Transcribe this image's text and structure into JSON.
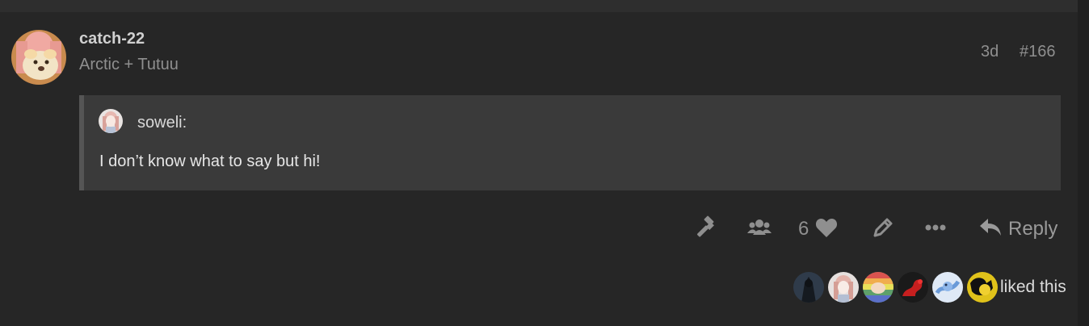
{
  "post": {
    "username": "catch-22",
    "user_title": "Arctic + Tutuu",
    "date": "3d",
    "post_number": "#166",
    "quote": {
      "author": "soweli:",
      "text": "I don’t know what to say but hi!"
    },
    "actions": {
      "like_count": "6",
      "reply_label": "Reply"
    },
    "likes": {
      "suffix": "liked this",
      "avatars": [
        "liker-1",
        "liker-2",
        "liker-3",
        "liker-4",
        "liker-5",
        "liker-6"
      ]
    }
  },
  "icons": [
    "gavel-icon",
    "group-icon",
    "heart-icon",
    "pencil-icon",
    "ellipsis-icon",
    "reply-arrow-icon"
  ],
  "colors": {
    "background": "#262626",
    "quote_background": "#3a3a3a",
    "muted_text": "#8f8f8f"
  }
}
